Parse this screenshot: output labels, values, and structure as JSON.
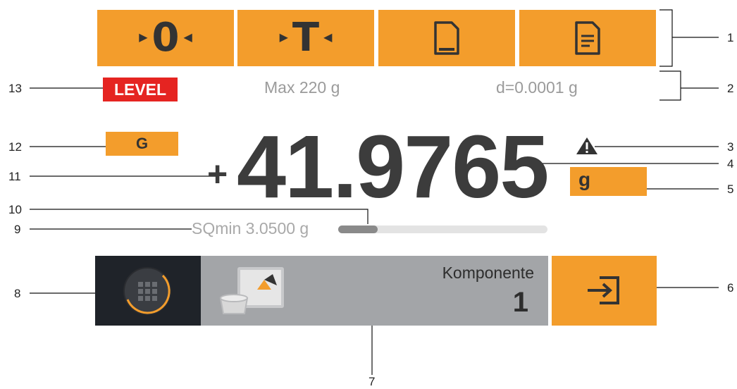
{
  "toolbar": {
    "zero_label": "0",
    "tare_label": "T",
    "doc1_icon": "document-blank-icon",
    "doc2_icon": "document-lines-icon",
    "color": "#f39d2c"
  },
  "info": {
    "level": "LEVEL",
    "max": "Max 220 g",
    "d": "d=0.0001 g",
    "level_color": "#e52421"
  },
  "weight": {
    "g_label": "G",
    "sign": "+",
    "value": "41.9765",
    "unit": "g",
    "warning_icon": "warning-icon"
  },
  "sqmin": {
    "label": "SQmin 3.0500 g",
    "progress_fraction": 0.19
  },
  "bottom_bar": {
    "menu_icon": "grid-menu-icon",
    "component_label": "Komponente",
    "component_number": "1",
    "transfer_icon": "transfer-in-icon"
  },
  "callouts": {
    "n1": "1",
    "n2": "2",
    "n3": "3",
    "n4": "4",
    "n5": "5",
    "n6": "6",
    "n7": "7",
    "n8": "8",
    "n9": "9",
    "n10": "10",
    "n11": "11",
    "n12": "12",
    "n13": "13"
  }
}
